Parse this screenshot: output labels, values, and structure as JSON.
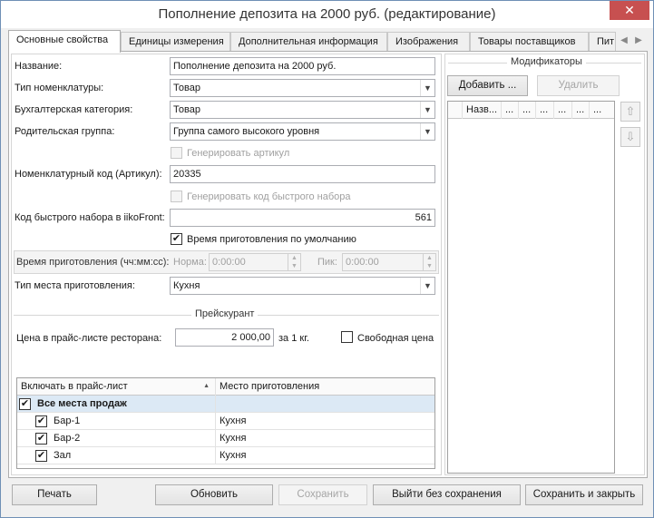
{
  "window": {
    "title": "Пополнение депозита на 2000 руб. (редактирование)",
    "close_icon": "✕"
  },
  "tabs": [
    {
      "label": "Основные свойства"
    },
    {
      "label": "Единицы измерения"
    },
    {
      "label": "Дополнительная информация"
    },
    {
      "label": "Изображения"
    },
    {
      "label": "Товары поставщиков"
    },
    {
      "label": "Пит"
    }
  ],
  "tab_scroll": {
    "left": "◀",
    "right": "▶"
  },
  "form": {
    "name_label": "Название:",
    "name_value": "Пополнение депозита на 2000 руб.",
    "type_label": "Тип номенклатуры:",
    "type_value": "Товар",
    "acc_label": "Бухгалтерская категория:",
    "acc_value": "Товар",
    "parent_label": "Родительская группа:",
    "parent_value": "Группа самого высокого уровня",
    "gen_article_label": "Генерировать артикул",
    "code_label": "Номенклатурный код (Артикул):",
    "code_value": "20335",
    "gen_fast_label": "Генерировать код быстрого набора",
    "fast_label": "Код быстрого набора в iikoFront:",
    "fast_value": "561",
    "default_cook_label": "Время приготовления по умолчанию",
    "cook_time_label": "Время приготовления (чч:мм:сс):",
    "norm_label": "Норма:",
    "norm_value": "0:00:00",
    "peak_label": "Пик:",
    "peak_value": "0:00:00",
    "place_type_label": "Тип места приготовления:",
    "place_type_value": "Кухня",
    "combo_arrow": "▼",
    "spin_up": "▲",
    "spin_down": "▼",
    "check_mark": "✔"
  },
  "pricelist": {
    "title": "Прейскурант",
    "price_label": "Цена в прайс-листе ресторана:",
    "price_value": "2 000,00",
    "unit_label": "за 1 кг.",
    "free_price_label": "Свободная цена",
    "columns": [
      "Включать в прайс-лист",
      "Место приготовления"
    ],
    "sort_icon": "▲",
    "rows": [
      {
        "name": "Все места продаж",
        "place": "",
        "checked": true,
        "group": true
      },
      {
        "name": "Бар-1",
        "place": "Кухня",
        "checked": true,
        "group": false
      },
      {
        "name": "Бар-2",
        "place": "Кухня",
        "checked": true,
        "group": false
      },
      {
        "name": "Зал",
        "place": "Кухня",
        "checked": true,
        "group": false
      }
    ]
  },
  "modifiers": {
    "title": "Модификаторы",
    "add_label": "Добавить ...",
    "delete_label": "Удалить",
    "columns": [
      "Назв...",
      "...",
      "...",
      "...",
      "...",
      "...",
      "..."
    ],
    "up_icon": "⇧",
    "down_icon": "⇩"
  },
  "footer": {
    "print": "Печать",
    "refresh": "Обновить",
    "save": "Сохранить",
    "exit": "Выйти без сохранения",
    "save_close": "Сохранить и закрыть"
  }
}
